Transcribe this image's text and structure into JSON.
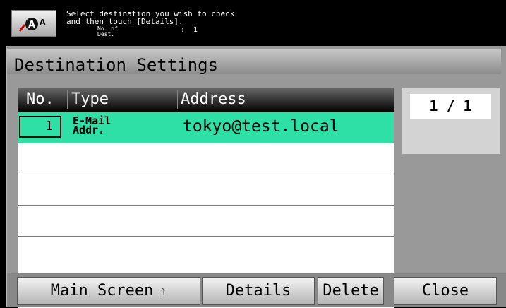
{
  "header": {
    "message_line1": "Select destination you wish to check",
    "message_line2": "and then touch [Details].",
    "count_label_line1": "No. of",
    "count_label_line2": "Dest.",
    "count_value": ":  1",
    "accessibility_icon": "accessibility-icon"
  },
  "page": {
    "title": "Destination Settings"
  },
  "table": {
    "columns": [
      "No.",
      "Type",
      "Address"
    ],
    "rows": [
      {
        "no": "1",
        "type": "E-Mail\nAddr.",
        "address": "tokyo@test.local",
        "selected": true
      }
    ]
  },
  "pager": {
    "text": "1 / 1"
  },
  "buttons": {
    "main_screen": "Main Screen",
    "main_screen_icon": "arrow-up-icon",
    "details": "Details",
    "delete": "Delete",
    "close": "Close"
  },
  "colors": {
    "selection": "#2ee0a5",
    "header_bg": "#000000"
  }
}
